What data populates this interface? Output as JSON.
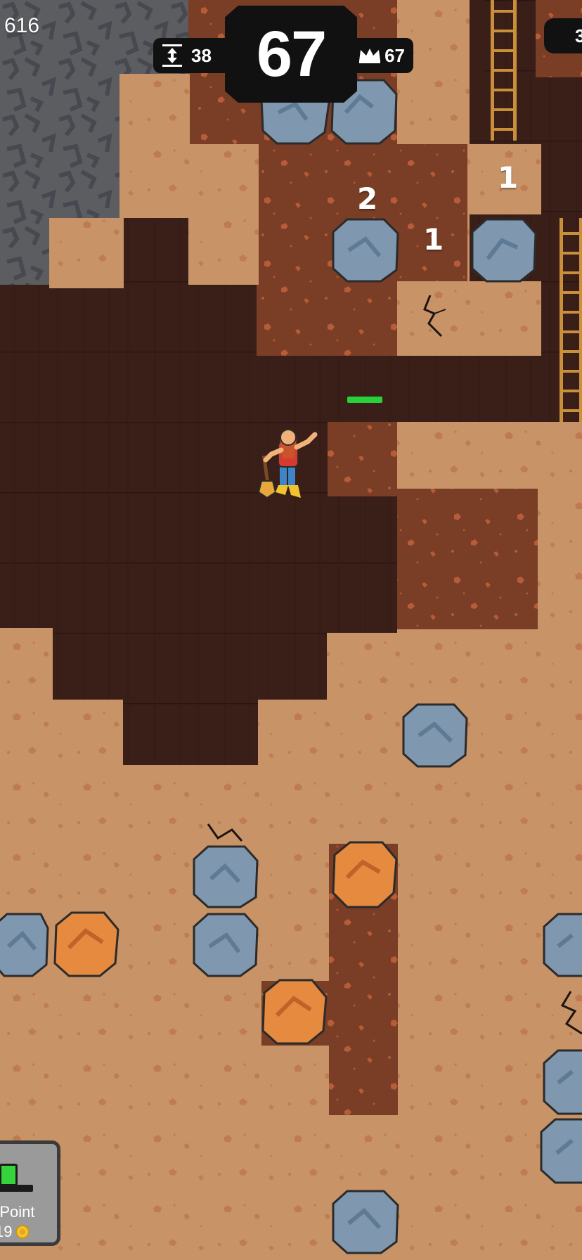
{
  "hud": {
    "left_counter": "616",
    "depth_value": "38",
    "score": "67",
    "best_value": "67",
    "right_counter": "3"
  },
  "tile_hits": {
    "upper_stone": "2",
    "middle_block": "1",
    "right_stone": "1"
  },
  "shop": {
    "label": "e Point",
    "sub": "19"
  },
  "colors": {
    "dirt_light": "#c89366",
    "dirt_dark": "#7a3d25",
    "tunnel": "#3a1f19",
    "rock_gray": "#5c5d60",
    "stone_blue": "#7f98b0",
    "copper_ore": "#e58a3f",
    "ladder": "#c98f3b",
    "health": "#27d13a"
  },
  "icons": {
    "depth": "depth-arrows-icon",
    "best": "crown-icon",
    "coin": "coin-icon"
  },
  "player": {
    "character": "bearded-miner",
    "tool": "shovel"
  }
}
